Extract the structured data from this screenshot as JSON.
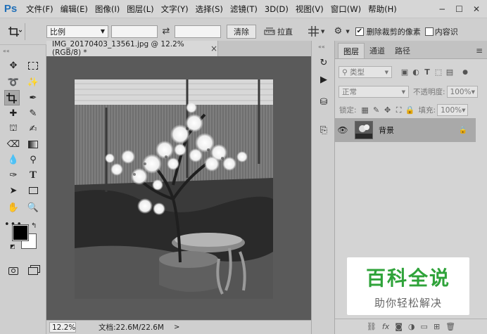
{
  "app": {
    "logo": "Ps"
  },
  "menu": [
    "文件(F)",
    "编辑(E)",
    "图像(I)",
    "图层(L)",
    "文字(Y)",
    "选择(S)",
    "滤镜(T)",
    "3D(D)",
    "视图(V)",
    "窗口(W)",
    "帮助(H)"
  ],
  "window_controls": {
    "minimize": "−",
    "maximize": "☐",
    "close": "✕"
  },
  "options": {
    "ratio": "比例",
    "swap": "⇄",
    "clear": "清除",
    "straighten": "拉直",
    "delete_cropped_label": "删除裁剪的像素",
    "delete_cropped_checked": true,
    "right_cut": "内容识"
  },
  "document": {
    "tab_title": "IMG_20170403_13561.jpg @ 12.2%(RGB/8) *",
    "close": "×",
    "zoom": "12.2%",
    "doc_info": "文档:22.6M/22.6M",
    "status_arrow": ">"
  },
  "layers_panel": {
    "tabs": [
      "图层",
      "通道",
      "路径"
    ],
    "active_tab": 0,
    "filter_kind": "类型",
    "blend_mode": "正常",
    "opacity_label": "不透明度:",
    "opacity_value": "100%",
    "lock_label": "锁定:",
    "fill_label": "填充:",
    "fill_value": "100%",
    "layers": [
      {
        "name": "背景",
        "visible": true,
        "locked": true
      }
    ],
    "bottom_icons": [
      "link-icon",
      "fx-icon",
      "mask-icon",
      "adjustment-icon",
      "group-icon",
      "new-layer-icon",
      "trash-icon"
    ],
    "bottom_fx": "fx"
  },
  "watermark": {
    "title": "百科全说",
    "subtitle": "助你轻松解决"
  },
  "colors": {
    "accent": "#1f6fb8",
    "watermark_green": "#2fa33a",
    "canvas_bg": "#5a5a5a"
  }
}
